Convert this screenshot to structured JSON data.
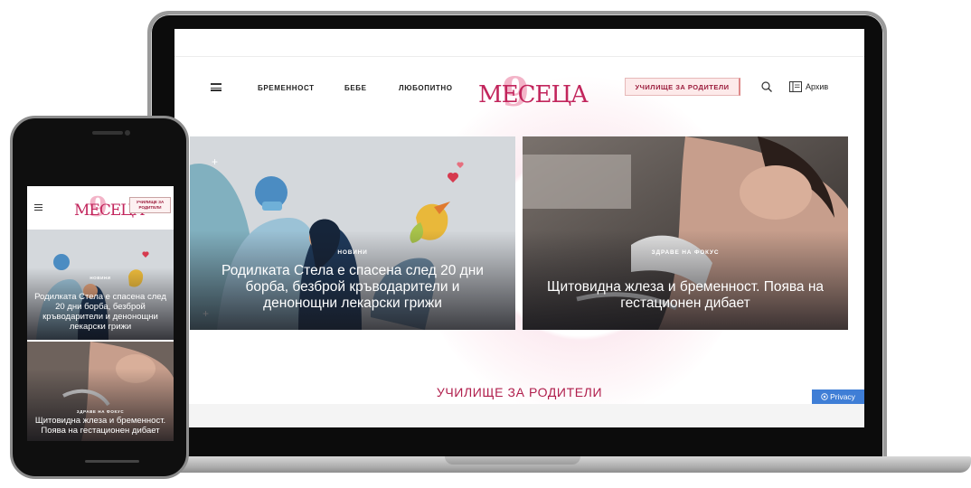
{
  "desktop": {
    "nav": {
      "links": [
        "БРЕМЕННОСТ",
        "БЕБЕ",
        "ЛЮБОПИТНО"
      ],
      "logo_number": "9",
      "logo_text": "МЕСЕЦА",
      "school_button": "УЧИЛИЩЕ ЗА РОДИТЕЛИ",
      "archive_label": "Архив"
    },
    "articles": [
      {
        "category": "НОВИНИ",
        "title": "Родилката Стела е спасена след 20 дни борба, безброй кръводарители и денонощни лекарски грижи"
      },
      {
        "category": "ЗДРАВЕ НА ФОКУС",
        "title": "Щитовидна жлеза и бременност. Поява на гестационен дибает"
      }
    ],
    "section_title": "УЧИЛИЩЕ ЗА РОДИТЕЛИ",
    "privacy_label": "Privacy"
  },
  "mobile": {
    "logo_number": "9",
    "logo_text": "МЕСЕЦА",
    "school_button": "УЧИЛИЩЕ ЗА РОДИТЕЛИ",
    "articles": [
      {
        "category": "НОВИНИ",
        "title": "Родилката Стела е спасена след 20 дни борба, безброй кръводарители и денонощни лекарски грижи"
      },
      {
        "category": "ЗДРАВЕ НА ФОКУС",
        "title": "Щитовидна жлеза и бременност. Поява на гестационен дибает"
      }
    ]
  },
  "colors": {
    "brand": "#c2255c",
    "brand_light": "#f3b4c8",
    "privacy_bg": "#3f7ed6"
  },
  "icons": [
    "menu-icon",
    "search-icon",
    "archive-icon",
    "privacy-icon"
  ]
}
